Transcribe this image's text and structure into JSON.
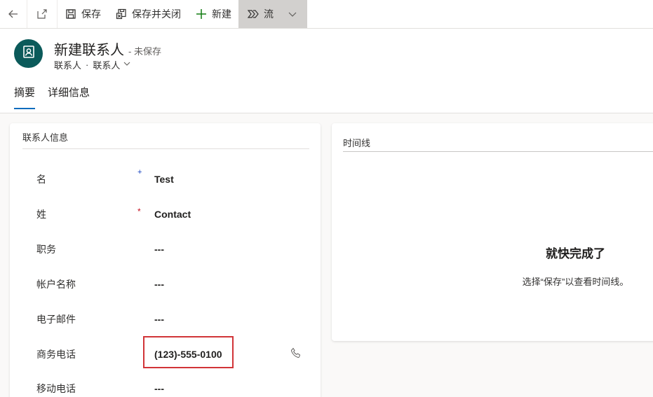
{
  "toolbar": {
    "back_icon": "back-arrow-icon",
    "popout_icon": "popout-icon",
    "save_label": "保存",
    "save_close_label": "保存并关闭",
    "new_label": "新建",
    "flow_label": "流"
  },
  "header": {
    "title": "新建联系人",
    "status": "- 未保存",
    "entity_type": "联系人",
    "separator": "·",
    "form_name": "联系人",
    "avatar_icon": "contact-card-icon"
  },
  "tabs": [
    {
      "label": "摘要",
      "active": true
    },
    {
      "label": "详细信息",
      "active": false
    }
  ],
  "contact_info": {
    "section_title": "联系人信息",
    "fields": [
      {
        "label": "名",
        "value": "Test",
        "required": "recommended"
      },
      {
        "label": "姓",
        "value": "Contact",
        "required": "required"
      },
      {
        "label": "职务",
        "value": "---"
      },
      {
        "label": "帐户名称",
        "value": "---"
      },
      {
        "label": "电子邮件",
        "value": "---"
      },
      {
        "label": "商务电话",
        "value": "(123)-555-0100"
      },
      {
        "label": "移动电话",
        "value": "---"
      }
    ],
    "required_marks": {
      "recommended": "+",
      "required": "*"
    }
  },
  "timeline": {
    "title": "时间线",
    "heading": "就快完成了",
    "message": "选择“保存”以查看时间线。"
  },
  "colors": {
    "accent": "#0f6cbd",
    "avatar_bg": "#0b5a5a",
    "highlight_border": "#d13438",
    "required_red": "#c50f1f"
  }
}
